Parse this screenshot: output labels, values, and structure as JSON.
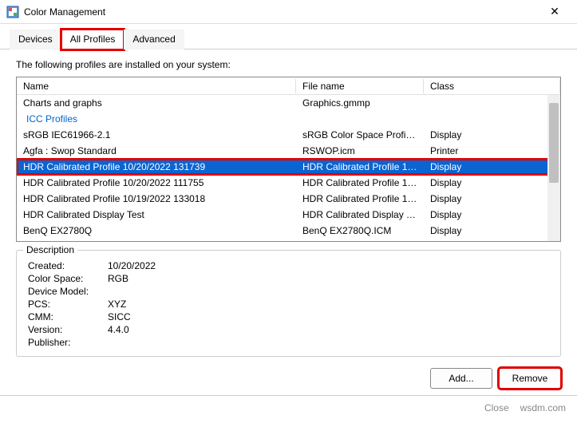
{
  "window": {
    "title": "Color Management"
  },
  "tabs": {
    "devices": "Devices",
    "all_profiles": "All Profiles",
    "advanced": "Advanced"
  },
  "instruction": "The following profiles are installed on your system:",
  "columns": {
    "name": "Name",
    "file": "File name",
    "class": "Class"
  },
  "group_icc": "ICC Profiles",
  "rows": {
    "r0": {
      "name": "Charts and graphs",
      "file": "Graphics.gmmp",
      "class": ""
    },
    "r1": {
      "name": "sRGB IEC61966-2.1",
      "file": "sRGB Color Space Profile.ic...",
      "class": "Display"
    },
    "r2": {
      "name": "Agfa : Swop Standard",
      "file": "RSWOP.icm",
      "class": "Printer"
    },
    "r3": {
      "name": "HDR Calibrated Profile 10/20/2022 131739",
      "file": "HDR Calibrated Profile 10-...",
      "class": "Display"
    },
    "r4": {
      "name": "HDR Calibrated Profile 10/20/2022 111755",
      "file": "HDR Calibrated Profile 10-...",
      "class": "Display"
    },
    "r5": {
      "name": "HDR Calibrated Profile 10/19/2022 133018",
      "file": "HDR Calibrated Profile 10-...",
      "class": "Display"
    },
    "r6": {
      "name": "HDR Calibrated Display Test",
      "file": "HDR Calibrated Display Tes...",
      "class": "Display"
    },
    "r7": {
      "name": "BenQ EX2780Q",
      "file": "BenQ EX2780Q.ICM",
      "class": "Display"
    }
  },
  "desc": {
    "legend": "Description",
    "created_l": "Created:",
    "created_v": "10/20/2022",
    "colorspace_l": "Color Space:",
    "colorspace_v": "RGB",
    "model_l": "Device Model:",
    "model_v": "",
    "pcs_l": "PCS:",
    "pcs_v": "XYZ",
    "cmm_l": "CMM:",
    "cmm_v": "SICC",
    "version_l": "Version:",
    "version_v": "4.4.0",
    "publisher_l": "Publisher:",
    "publisher_v": ""
  },
  "buttons": {
    "add": "Add...",
    "remove": "Remove"
  },
  "footer": {
    "close": "Close",
    "watermark": "wsdm.com"
  }
}
